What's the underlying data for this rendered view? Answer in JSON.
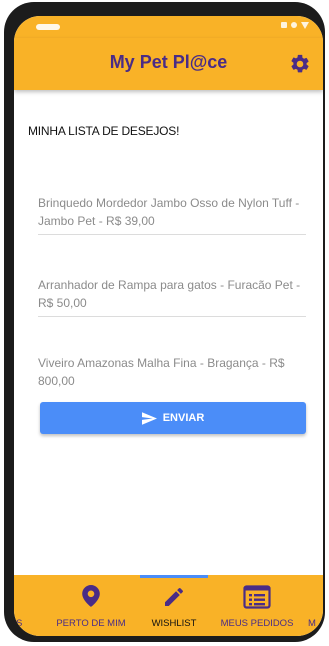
{
  "app": {
    "title": "My Pet Pl@ce"
  },
  "content": {
    "list_title": "MINHA LISTA DE DESEJOS!",
    "items": [
      {
        "text": "Brinquedo Mordedor Jambo Osso de Nylon Tuff - Jambo Pet - R$ 39,00"
      },
      {
        "text": "Arranhador de Rampa para gatos - Furacão Pet - R$ 50,00"
      },
      {
        "text": "Viveiro Amazonas Malha Fina - Bragança - R$ 800,00"
      }
    ],
    "send_label": "ENVIAR"
  },
  "nav": {
    "partial_left": "AS",
    "items": [
      {
        "label": "PERTO DE MIM",
        "icon": "map-pin-icon"
      },
      {
        "label": "WISHLIST",
        "icon": "pencil-icon",
        "active": true
      },
      {
        "label": "MEUS PEDIDOS",
        "icon": "list-icon"
      }
    ],
    "partial_right": "M"
  },
  "colors": {
    "primary": "#f9b227",
    "accent": "#4a2c86",
    "button": "#4b8df8"
  }
}
